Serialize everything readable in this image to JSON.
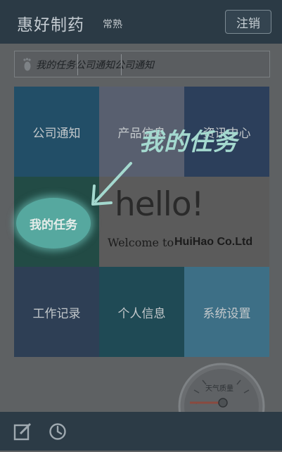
{
  "header": {
    "app_title": "惠好制药",
    "city": "常熟",
    "logout_label": "注销"
  },
  "marquee": {
    "text": "我的任务公司通知公司通知"
  },
  "grid": {
    "tiles": [
      {
        "label": "公司通知",
        "color": "#224e67"
      },
      {
        "label": "产品信息",
        "color": "#585f6f"
      },
      {
        "label": "资讯中心",
        "color": "#2c3f5b"
      },
      {
        "label": "我的任务",
        "color": "#224b45"
      },
      {
        "label": "工作记录",
        "color": "#2e3f55"
      },
      {
        "label": "个人信息",
        "color": "#1f4a55"
      },
      {
        "label": "系统设置",
        "color": "#3d6f86"
      }
    ]
  },
  "hello_card": {
    "hello": "hello!",
    "welcome": "Welcome to",
    "company": "HuiHao Co.Ltd"
  },
  "callout": {
    "label": "我的任务",
    "color": "#a4d9cf"
  },
  "gauge": {
    "label": "天气质量"
  },
  "bottom_bar": {
    "icons": [
      "edit-icon",
      "clock-icon"
    ]
  }
}
